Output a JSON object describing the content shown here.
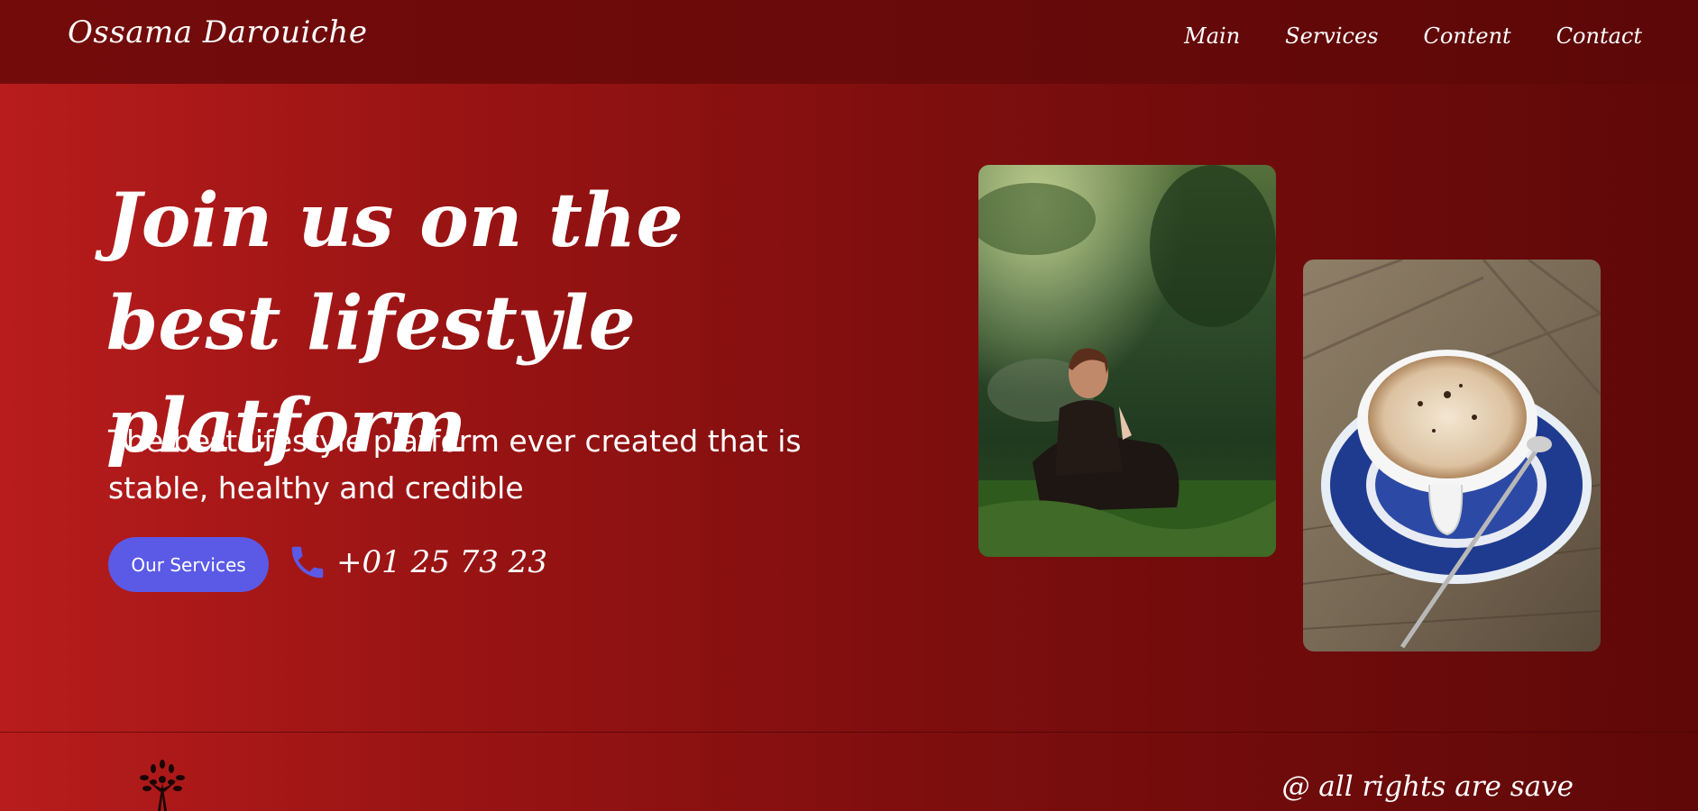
{
  "header": {
    "brand": "Ossama Darouiche",
    "nav": [
      "Main",
      "Services",
      "Content",
      "Contact"
    ]
  },
  "hero": {
    "title": "Join us on the best lifestyle platform",
    "subtitle": "The best lifestyle platform ever created that is stable, healthy and credible",
    "services_button": "Our Services",
    "phone": "+01 25 73 23",
    "phone_icon": "phone-icon"
  },
  "images": [
    {
      "name": "man-praying-in-forest-photo"
    },
    {
      "name": "cappuccino-cup-photo"
    }
  ],
  "footer": {
    "logo_icon": "tree-person-logo",
    "copyright": "@ all rights are save"
  },
  "colors": {
    "header_bg": "#6a0a0a",
    "hero_gradient_start": "#b81c1c",
    "hero_gradient_end": "#5f0808",
    "button_bg": "#5a5ae6",
    "text": "#ffffff"
  }
}
